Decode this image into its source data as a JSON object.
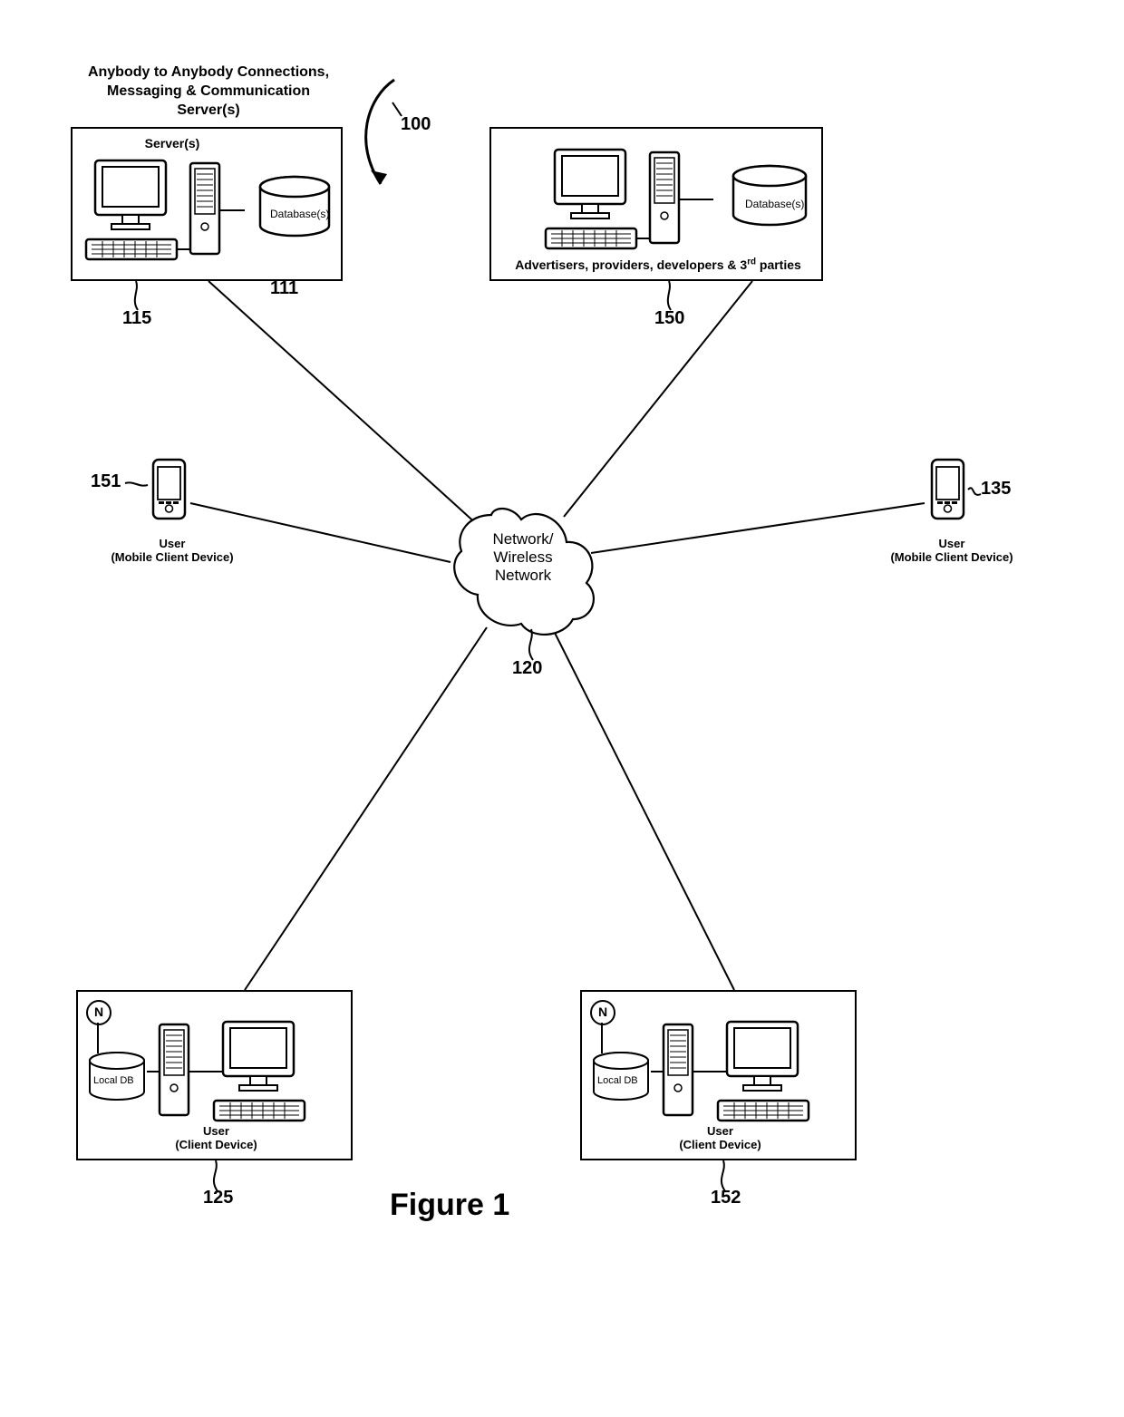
{
  "header": {
    "title_line1": "Anybody to Anybody Connections,",
    "title_line2": "Messaging & Communication",
    "title_line3": "Server(s)"
  },
  "nodes": {
    "server_box": {
      "label": "Server(s)",
      "db_label": "Database(s)",
      "ref_db": "111",
      "ref_box": "115"
    },
    "advertiser_box": {
      "label_html": "Advertisers, providers, developers & 3rd parties",
      "db_label": "Database(s)",
      "ref_box": "150"
    },
    "mobile_left": {
      "label_line1": "User",
      "label_line2": "(Mobile Client Device)",
      "ref": "151"
    },
    "mobile_right": {
      "label_line1": "User",
      "label_line2": "(Mobile Client Device)",
      "ref": "135"
    },
    "network": {
      "line1": "Network/",
      "line2": "Wireless",
      "line3": "Network",
      "ref": "120"
    },
    "client_bottom_left": {
      "label_line1": "User",
      "label_line2": "(Client Device)",
      "db_label": "Local DB",
      "badge": "N",
      "ref": "125"
    },
    "client_bottom_right": {
      "label_line1": "User",
      "label_line2": "(Client Device)",
      "db_label": "Local DB",
      "badge": "N",
      "ref": "152"
    },
    "arrow_ref": "100"
  },
  "figure_title": "Figure 1"
}
